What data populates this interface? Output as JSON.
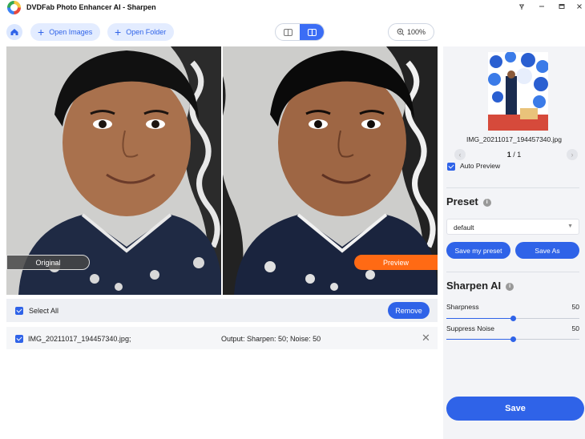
{
  "window": {
    "title": "DVDFab Photo Enhancer AI - Sharpen",
    "controls": [
      "pin-icon",
      "minimize-icon",
      "maximize-icon",
      "close-icon"
    ]
  },
  "toolbar": {
    "open_images_label": "Open Images",
    "open_folder_label": "Open Folder",
    "zoom_label": "100%"
  },
  "compare": {
    "original_label": "Original",
    "preview_label": "Preview"
  },
  "file_list": {
    "select_all_label": "Select All",
    "remove_label": "Remove",
    "files": [
      {
        "name": "IMG_20211017_194457340.jpg;",
        "output": "Output: Sharpen: 50; Noise: 50",
        "checked": true
      }
    ]
  },
  "right_panel": {
    "thumbnail_name": "IMG_20211017_194457340.jpg",
    "page_current": "1",
    "page_total": "/ 1",
    "auto_preview_label": "Auto Preview",
    "preset_title": "Preset",
    "preset_value": "default",
    "save_my_preset_label": "Save my preset",
    "save_as_label": "Save As",
    "sharpen_title": "Sharpen AI",
    "sliders": [
      {
        "label": "Sharpness",
        "value": "50",
        "fraction": 0.5
      },
      {
        "label": "Suppress Noise",
        "value": "50",
        "fraction": 0.5
      }
    ],
    "save_label": "Save"
  },
  "colors": {
    "accent": "#2f63e8",
    "preview_badge": "#ff6a14",
    "panel_bg": "#f3f4f7"
  }
}
